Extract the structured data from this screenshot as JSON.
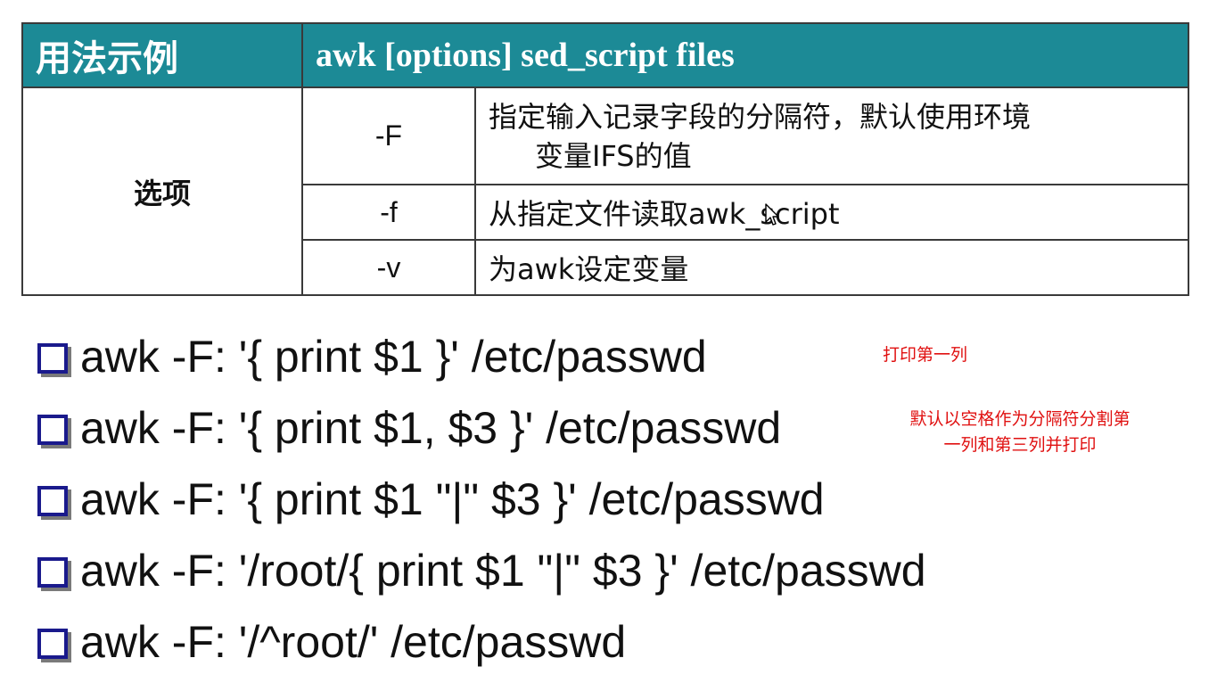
{
  "table": {
    "header": {
      "col1": "用法示例",
      "col2": "awk [options] sed_script files"
    },
    "options_label": "选项",
    "rows": [
      {
        "flag": "-F",
        "desc_line1": "指定输入记录字段的分隔符，默认使用环境",
        "desc_line2": "变量IFS的值"
      },
      {
        "flag": "-f",
        "desc_line1": "从指定文件读取awk_script",
        "desc_line2": ""
      },
      {
        "flag": "-v",
        "desc_line1": "为awk设定变量",
        "desc_line2": ""
      }
    ]
  },
  "examples": [
    "awk -F: '{ print $1 }' /etc/passwd",
    "awk -F: '{ print $1, $3 }' /etc/passwd",
    "awk -F: '{ print $1 \"|\" $3 }' /etc/passwd",
    "awk -F: '/root/{ print $1 \"|\" $3 }' /etc/passwd",
    "awk -F: '/^root/' /etc/passwd"
  ],
  "notes": {
    "note1": "打印第一列",
    "note2_line1": "默认以空格作为分隔符分割第",
    "note2_line2": "一列和第三列并打印"
  },
  "colors": {
    "header_bg": "#1c8a96",
    "bullet_box": "#1a1a8c",
    "note_red": "#e01010"
  },
  "icons": {
    "bullet": "checkbox-square-icon",
    "cursor": "mouse-pointer-icon"
  }
}
